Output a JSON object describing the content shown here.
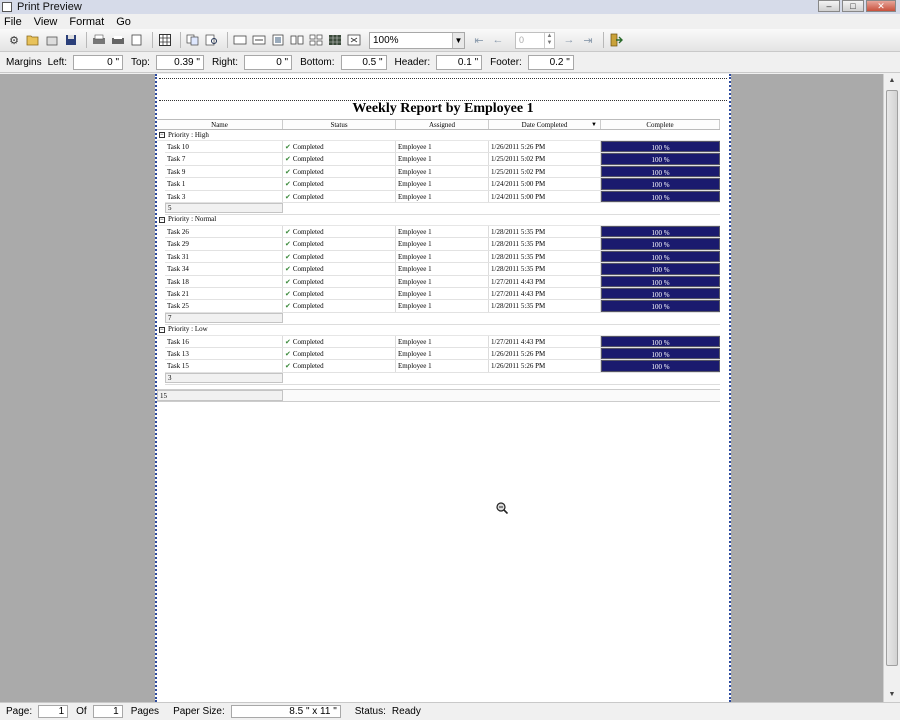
{
  "window": {
    "title": "Print Preview"
  },
  "menu": [
    "File",
    "View",
    "Format",
    "Go"
  ],
  "toolbar": {
    "zoom": "100%",
    "page_input": "0"
  },
  "margins": {
    "label": "Margins",
    "fields": [
      {
        "label": "Left:",
        "value": "0 \""
      },
      {
        "label": "Top:",
        "value": "0.39 \""
      },
      {
        "label": "Right:",
        "value": "0 \""
      },
      {
        "label": "Bottom:",
        "value": "0.5 \""
      },
      {
        "label": "Header:",
        "value": "0.1 \""
      },
      {
        "label": "Footer:",
        "value": "0.2 \""
      }
    ]
  },
  "report": {
    "title": "Weekly Report by Employee 1",
    "columns": [
      "Name",
      "Status",
      "Assigned",
      "Date Completed",
      "Complete"
    ],
    "groups": [
      {
        "label": "Priority : High",
        "rows": [
          [
            "Task 10",
            "Completed",
            "Employee 1",
            "1/26/2011 5:26 PM",
            "100 %"
          ],
          [
            "Task 7",
            "Completed",
            "Employee 1",
            "1/25/2011 5:02 PM",
            "100 %"
          ],
          [
            "Task 9",
            "Completed",
            "Employee 1",
            "1/25/2011 5:02 PM",
            "100 %"
          ],
          [
            "Task 1",
            "Completed",
            "Employee 1",
            "1/24/2011 5:00 PM",
            "100 %"
          ],
          [
            "Task 3",
            "Completed",
            "Employee 1",
            "1/24/2011 5:00 PM",
            "100 %"
          ]
        ],
        "count": "5"
      },
      {
        "label": "Priority : Normal",
        "rows": [
          [
            "Task 26",
            "Completed",
            "Employee 1",
            "1/28/2011 5:35 PM",
            "100 %"
          ],
          [
            "Task 29",
            "Completed",
            "Employee 1",
            "1/28/2011 5:35 PM",
            "100 %"
          ],
          [
            "Task 31",
            "Completed",
            "Employee 1",
            "1/28/2011 5:35 PM",
            "100 %"
          ],
          [
            "Task 34",
            "Completed",
            "Employee 1",
            "1/28/2011 5:35 PM",
            "100 %"
          ],
          [
            "Task 18",
            "Completed",
            "Employee 1",
            "1/27/2011 4:43 PM",
            "100 %"
          ],
          [
            "Task 21",
            "Completed",
            "Employee 1",
            "1/27/2011 4:43 PM",
            "100 %"
          ],
          [
            "Task 25",
            "Completed",
            "Employee 1",
            "1/28/2011 5:35 PM",
            "100 %"
          ]
        ],
        "count": "7"
      },
      {
        "label": "Priority : Low",
        "rows": [
          [
            "Task 16",
            "Completed",
            "Employee 1",
            "1/27/2011 4:43 PM",
            "100 %"
          ],
          [
            "Task 13",
            "Completed",
            "Employee 1",
            "1/26/2011 5:26 PM",
            "100 %"
          ],
          [
            "Task 15",
            "Completed",
            "Employee 1",
            "1/26/2011 5:26 PM",
            "100 %"
          ]
        ],
        "count": "3"
      }
    ],
    "total": "15"
  },
  "status": {
    "page_label": "Page:",
    "page": "1",
    "of_label": "Of",
    "of": "1",
    "pages_label": "Pages",
    "paper_label": "Paper Size:",
    "paper": "8.5 \" x 11 \"",
    "status_label": "Status:",
    "status": "Ready"
  }
}
